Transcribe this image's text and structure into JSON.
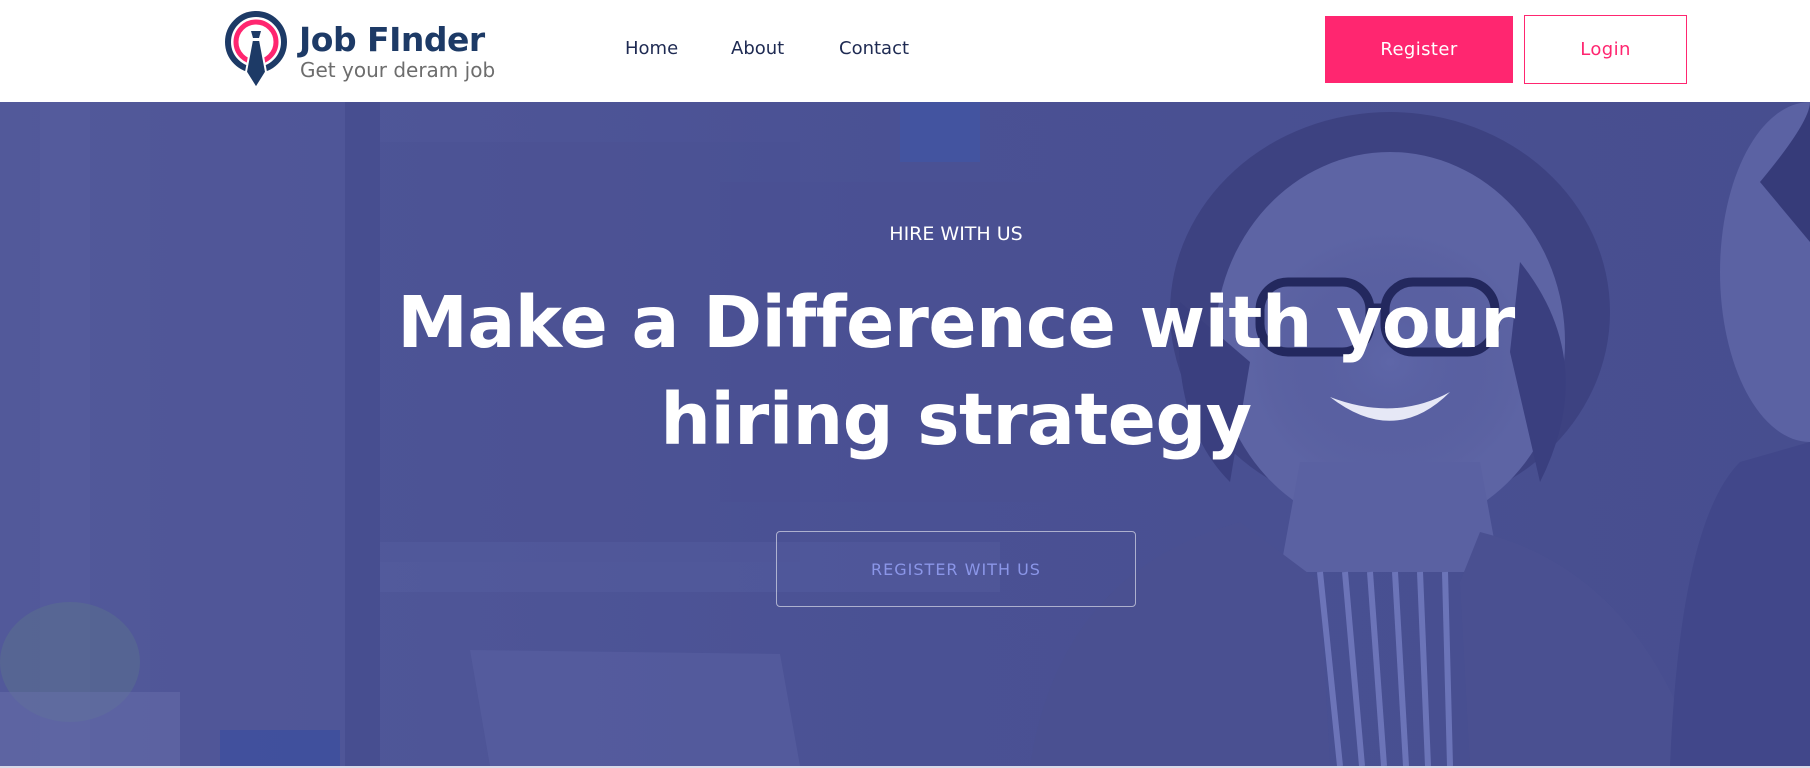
{
  "brand": {
    "name": "Job FInder",
    "tagline": "Get your deram job",
    "colors": {
      "navy": "#1d3a66",
      "accent": "#ff2670"
    }
  },
  "nav": {
    "links": [
      {
        "label": "Home"
      },
      {
        "label": "About"
      },
      {
        "label": "Contact"
      }
    ]
  },
  "header_actions": {
    "register_label": "Register",
    "login_label": "Login"
  },
  "hero": {
    "eyebrow": "HIRE WITH US",
    "title_line1": "Make a Difference with your",
    "title_line2": "hiring strategy",
    "cta_label": "REGISTER WITH US",
    "overlay_color": "#4c5395"
  }
}
